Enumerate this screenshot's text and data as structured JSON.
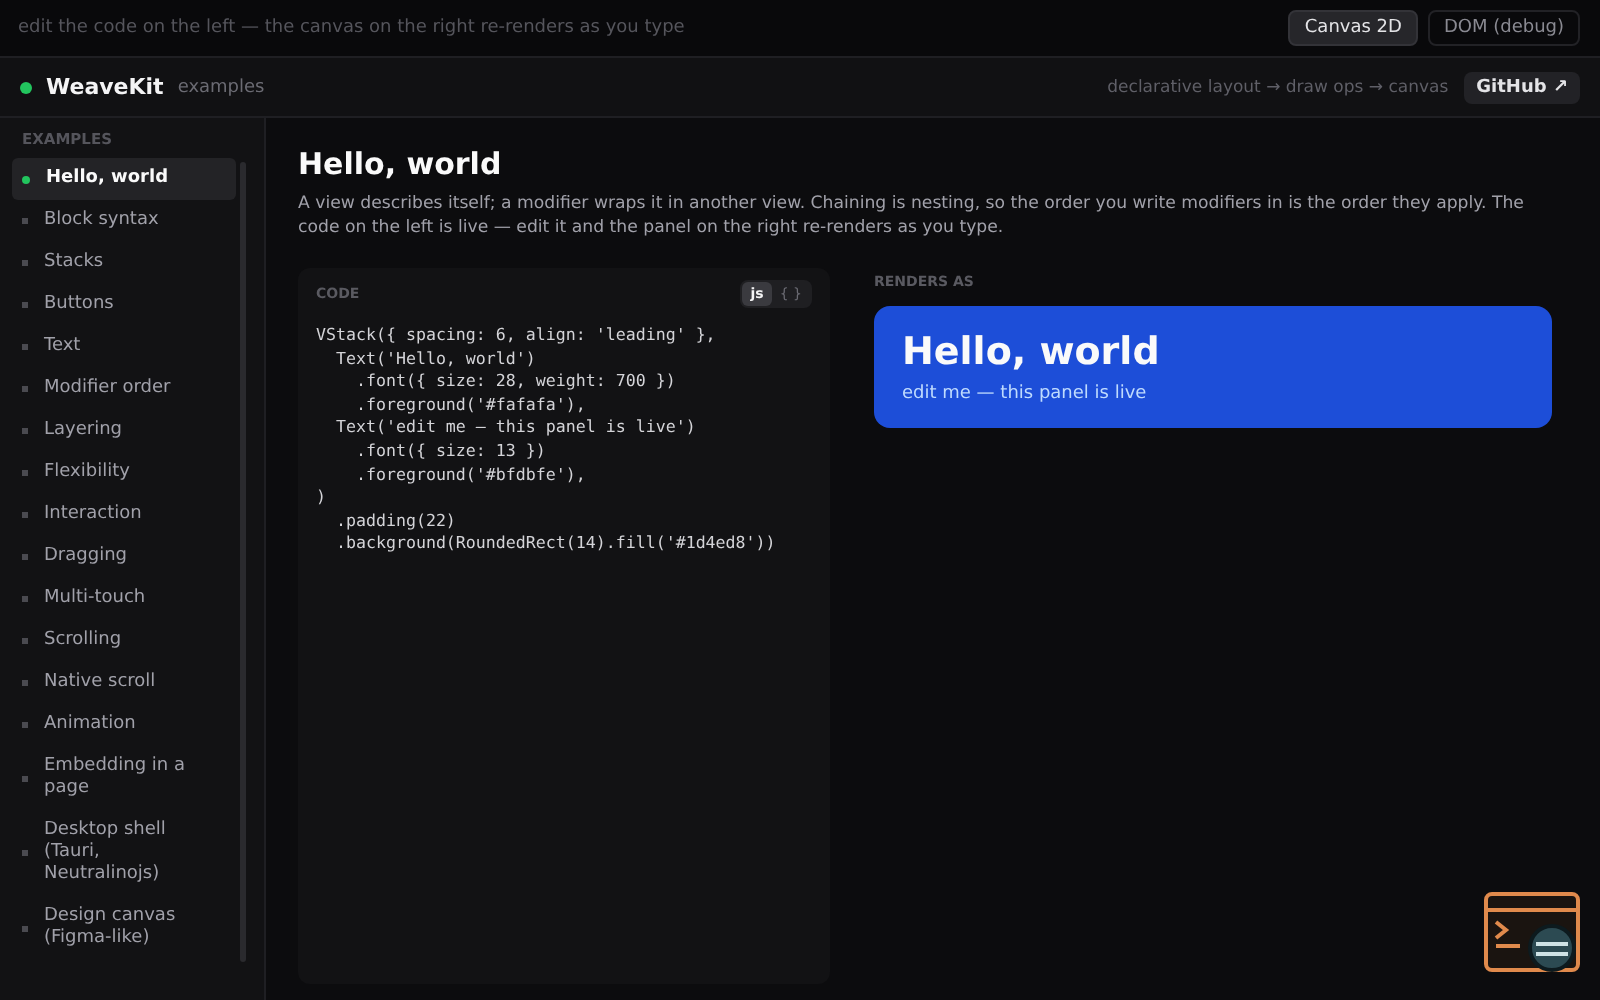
{
  "top_bar": {
    "hint": "edit the code on the left — the canvas on the right re-renders as you type",
    "modes": [
      {
        "label": "Canvas 2D",
        "selected": true
      },
      {
        "label": "DOM (debug)",
        "selected": false
      }
    ]
  },
  "header": {
    "brand": "WeaveKit",
    "subtitle": "examples",
    "pipeline": "declarative layout → draw ops → canvas",
    "github": "GitHub ↗"
  },
  "sidebar": {
    "heading": "EXAMPLES",
    "items": [
      {
        "label": "Hello, world",
        "selected": true
      },
      {
        "label": "Block syntax",
        "selected": false
      },
      {
        "label": "Stacks",
        "selected": false
      },
      {
        "label": "Buttons",
        "selected": false
      },
      {
        "label": "Text",
        "selected": false
      },
      {
        "label": "Modifier order",
        "selected": false
      },
      {
        "label": "Layering",
        "selected": false
      },
      {
        "label": "Flexibility",
        "selected": false
      },
      {
        "label": "Interaction",
        "selected": false
      },
      {
        "label": "Dragging",
        "selected": false
      },
      {
        "label": "Multi-touch",
        "selected": false
      },
      {
        "label": "Scrolling",
        "selected": false
      },
      {
        "label": "Native scroll",
        "selected": false
      },
      {
        "label": "Animation",
        "selected": false
      },
      {
        "label": "Embedding in a page",
        "selected": false
      },
      {
        "label": "Desktop shell (Tauri, Neutralinojs)",
        "selected": false
      },
      {
        "label": "Design canvas (Figma-like)",
        "selected": false
      }
    ]
  },
  "page": {
    "title": "Hello, world",
    "description": "A view describes itself; a modifier wraps it in another view. Chaining is nesting, so the order you write modifiers in is the order they apply. The code on the left is live — edit it and the panel on the right re-renders as you type."
  },
  "code": {
    "label": "CODE",
    "syntax": [
      {
        "label": "js",
        "selected": true
      },
      {
        "label": "{ }",
        "selected": false
      }
    ],
    "lines": [
      "VStack({ spacing: 6, align: 'leading' },",
      "  Text('Hello, world')",
      "    .font({ size: 28, weight: 700 })",
      "    .foreground('#fafafa'),",
      "  Text('edit me — this panel is live')",
      "    .font({ size: 13 })",
      "    .foreground('#bfdbfe'),",
      ")",
      "  .padding(22)",
      "  .background(RoundedRect(14).fill('#1d4ed8'))"
    ]
  },
  "preview": {
    "label": "RENDERS AS",
    "title": "Hello, world",
    "subtitle": "edit me — this panel is live",
    "color": "#1d4ed8"
  }
}
